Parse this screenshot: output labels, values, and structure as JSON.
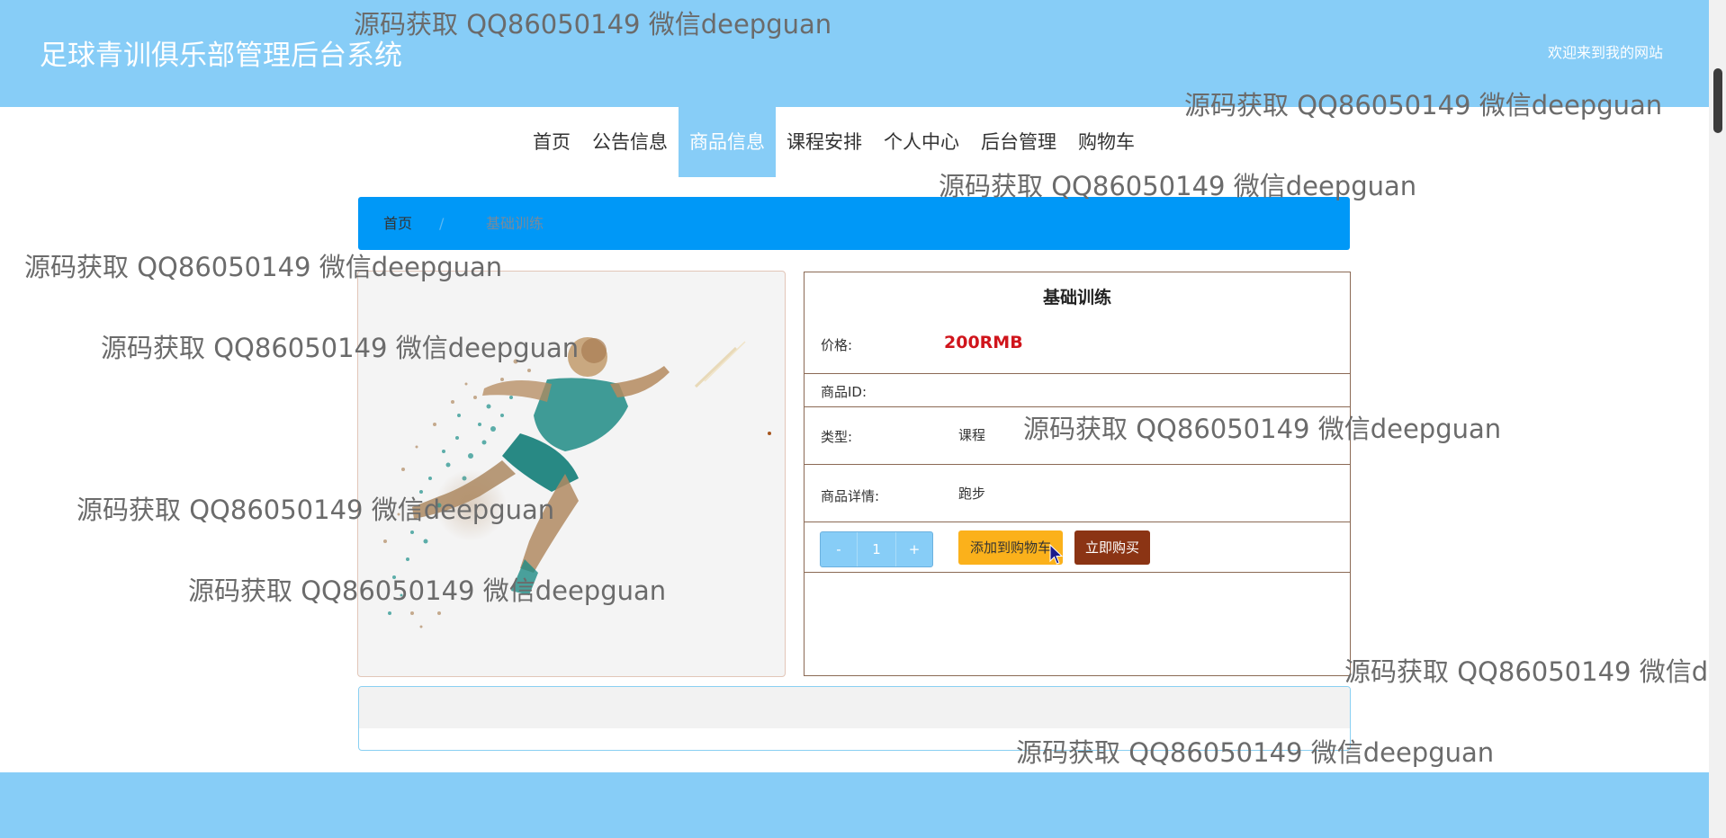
{
  "header": {
    "site_title": "足球青训俱乐部管理后台系统",
    "welcome": "欢迎来到我的网站"
  },
  "nav": {
    "items": [
      "首页",
      "公告信息",
      "商品信息",
      "课程安排",
      "个人中心",
      "后台管理",
      "购物车"
    ],
    "active": "商品信息"
  },
  "breadcrumb": {
    "home": "首页",
    "separator": "/",
    "current": "基础训练"
  },
  "product": {
    "image_icon": "runner-particle-image",
    "title": "基础训练",
    "price_label": "价格:",
    "price": "200RMB",
    "id_label": "商品ID:",
    "id_value": "",
    "type_label": "类型:",
    "type_value": "课程",
    "detail_label": "商品详情:",
    "detail_value": "跑步"
  },
  "actions": {
    "minus": "-",
    "quantity": "1",
    "plus": "+",
    "add_to_cart": "添加到购物车",
    "buy_now": "立即购买"
  },
  "watermark": "源码获取 QQ86050149 微信deepguan",
  "colors": {
    "header_bg": "#87cdf7",
    "breadcrumb_bg": "#0098f7",
    "price": "#d0151c",
    "cart_button": "#fbb11b",
    "buy_button": "#8b3414"
  }
}
